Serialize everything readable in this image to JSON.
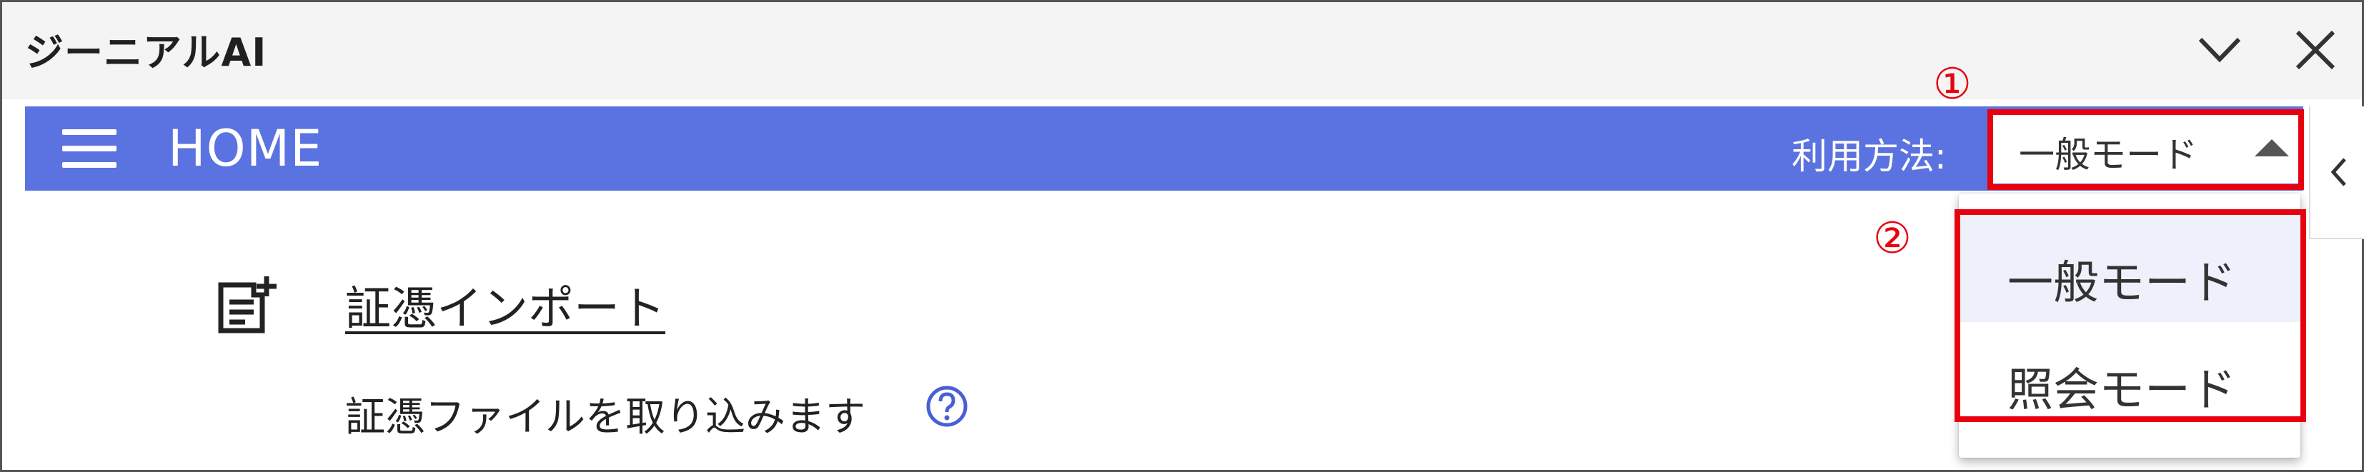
{
  "window": {
    "title": "ジーニアルAI",
    "collapse_icon": "chevron-down-icon",
    "close_icon": "close-icon"
  },
  "header": {
    "menu_icon": "hamburger-menu-icon",
    "title": "HOME",
    "mode_label": "利用方法:",
    "mode_selected": "一般モード",
    "mode_caret_icon": "caret-up-icon",
    "side_tab_icon": "chevron-left-icon",
    "accent_color": "#5b73e0"
  },
  "dropdown": {
    "options": [
      {
        "label": "一般モード",
        "selected": true
      },
      {
        "label": "照会モード",
        "selected": false
      }
    ]
  },
  "annotations": {
    "callout_1": "①",
    "callout_2": "②",
    "color": "#e8000f"
  },
  "main": {
    "import_icon": "add-document-icon",
    "import_link": "証憑インポート",
    "import_description": "証憑ファイルを取り込みます",
    "help_icon": "help-icon"
  }
}
